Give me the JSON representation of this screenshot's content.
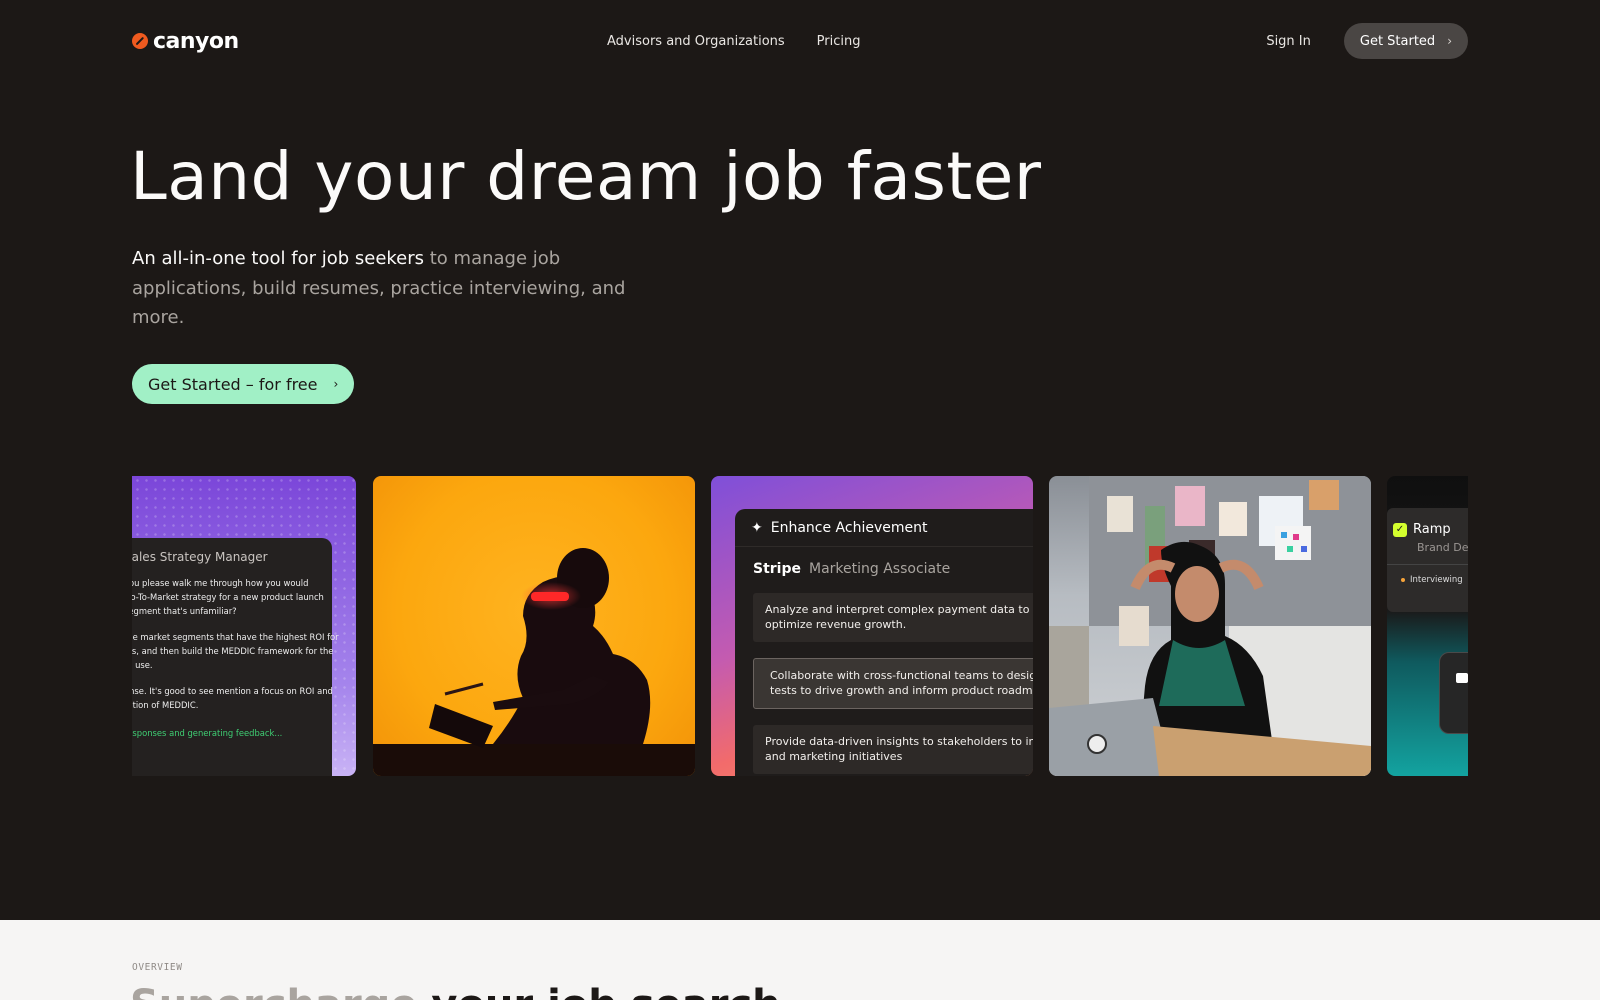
{
  "nav": {
    "logo_text": "canyon",
    "links": [
      {
        "label": "Advisors and Organizations"
      },
      {
        "label": "Pricing"
      }
    ],
    "sign_in": "Sign In",
    "get_started": "Get Started"
  },
  "hero": {
    "title": "Land your dream job faster",
    "subtitle_highlight": "An all-in-one tool for job seekers",
    "subtitle_rest": " to manage job applications, build resumes, practice interviewing, and more.",
    "cta": "Get Started – for free"
  },
  "cards": {
    "interview": {
      "role": "Sales Strategy Manager",
      "question": "you please walk me through how you would\nGo-To-Market strategy for a new product launch\nsegment that's unfamiliar?",
      "answer": "the market segments that have the highest ROI for\ncts, and then build the MEDDIC framework for the\nto use.",
      "feedback": "onse. It's good to see mention a focus on ROI and\nration of MEDDIC.",
      "status": "responses and generating feedback..."
    },
    "achievement": {
      "header": "Enhance Achievement",
      "company": "Stripe",
      "position": "Marketing Associate",
      "bullets": [
        "Analyze and interpret complex payment data to info\noptimize revenue growth.",
        "Collaborate with cross-functional teams to design\ntests to drive growth and inform product roadmap",
        "Provide data-driven insights to stakeholders to info\nand marketing initiatives"
      ]
    },
    "ramp": {
      "company": "Ramp",
      "role": "Brand Desi",
      "status": "Interviewing"
    }
  },
  "overview": {
    "label": "OVERVIEW",
    "heading_muted": "Supercharge",
    "heading_rest": " your job search"
  },
  "colors": {
    "background": "#1c1816",
    "accent_green": "#a1f0c6",
    "logo_orange": "#ef5a1f",
    "card_orange": "#fca70e"
  }
}
